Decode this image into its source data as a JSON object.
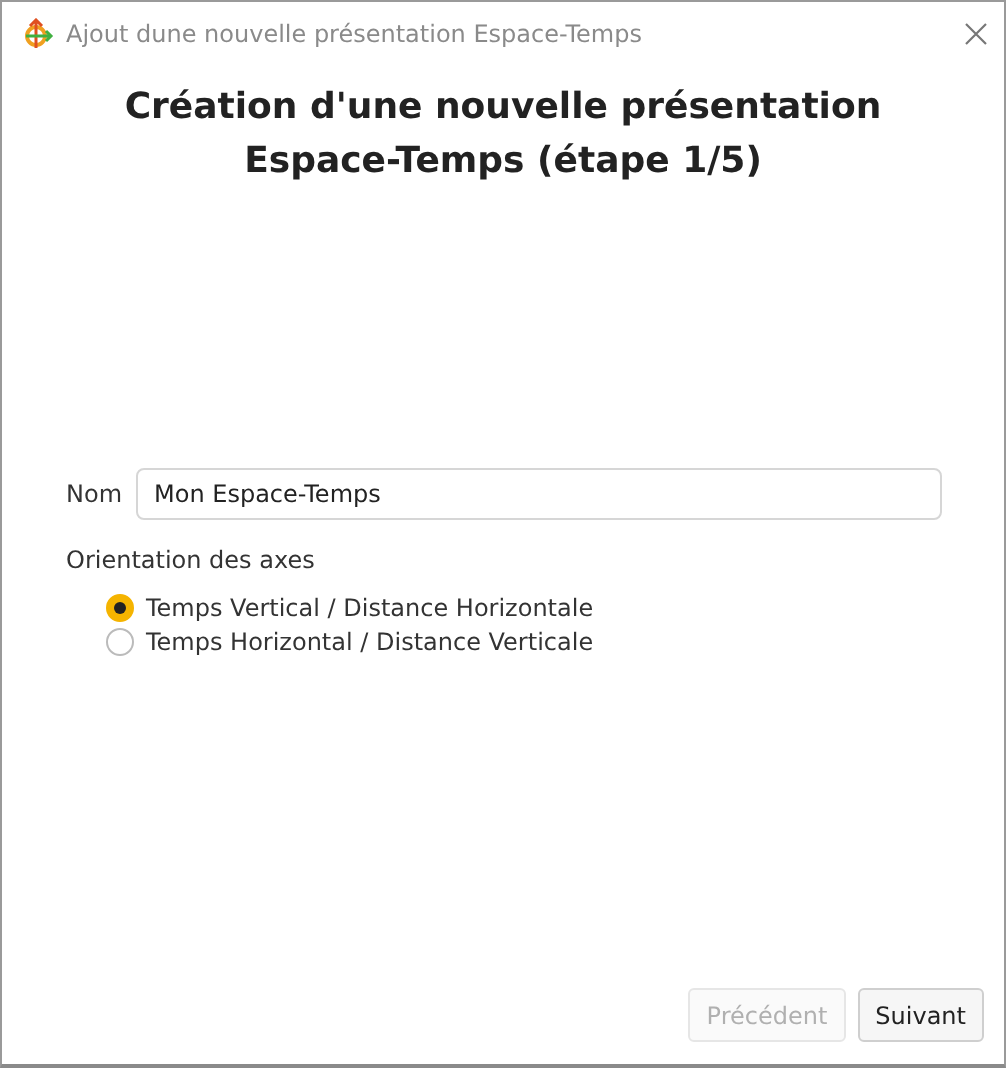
{
  "window": {
    "title": "Ajout dune nouvelle présentation Espace-Temps"
  },
  "heading": [
    "Création d'une nouvelle présentation",
    "Espace-Temps (étape 1/5)"
  ],
  "name_field": {
    "label": "Nom",
    "value": "Mon Espace-Temps"
  },
  "orientation": {
    "label": "Orientation des axes",
    "options": [
      {
        "label": "Temps Vertical / Distance Horizontale",
        "selected": true
      },
      {
        "label": "Temps Horizontal / Distance Verticale",
        "selected": false
      }
    ]
  },
  "buttons": [
    {
      "label": "Précédent",
      "disabled": true
    },
    {
      "label": "Suivant",
      "disabled": false
    }
  ]
}
